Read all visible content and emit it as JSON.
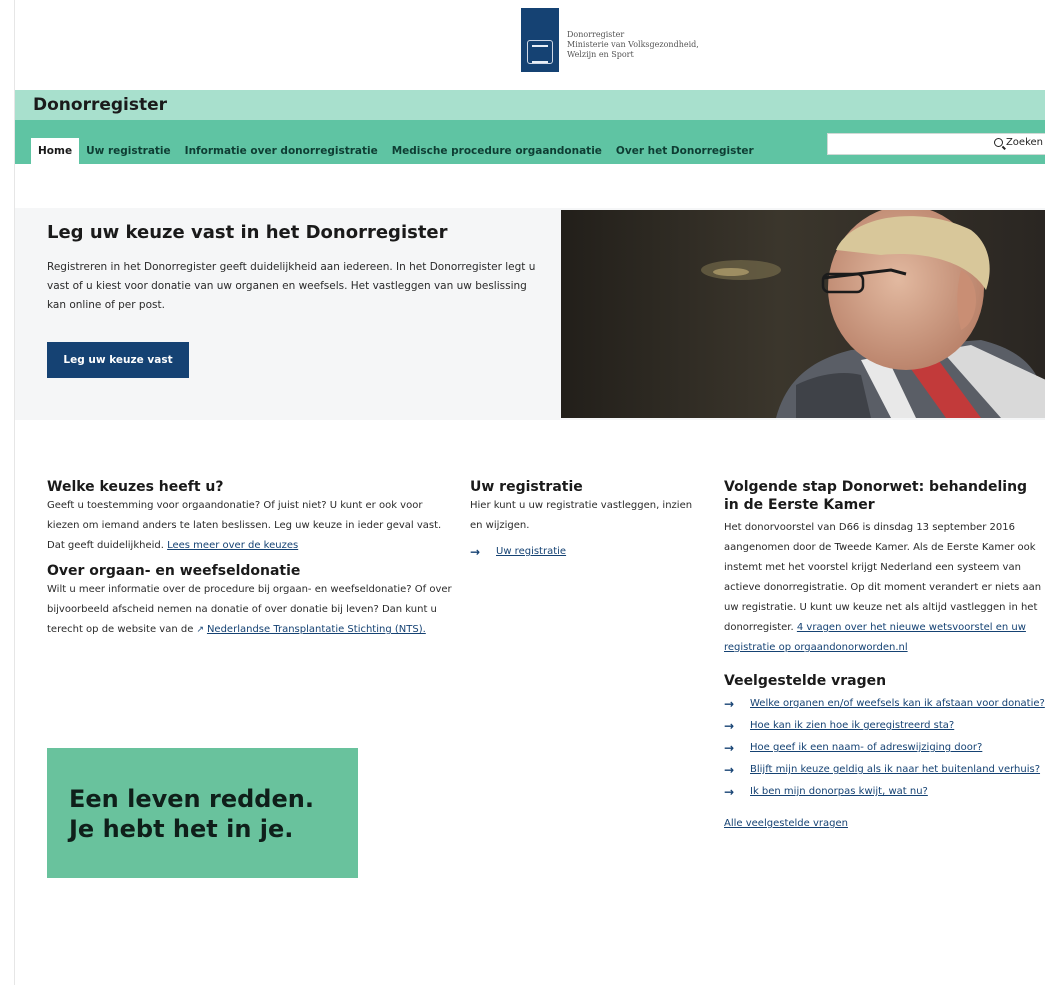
{
  "header": {
    "logo_lines": [
      "Donorregister",
      "Ministerie van Volksgezondheid,",
      "Welzijn en Sport"
    ],
    "site_title": "Donorregister"
  },
  "nav": {
    "items": [
      {
        "label": "Home",
        "active": true
      },
      {
        "label": "Uw registratie"
      },
      {
        "label": "Informatie over donorregistratie"
      },
      {
        "label": "Medische procedure orgaandonatie"
      },
      {
        "label": "Over het Donorregister"
      }
    ],
    "search_button": "Zoeken",
    "search_placeholder": ""
  },
  "hero": {
    "title": "Leg uw keuze vast in het Donorregister",
    "text": "Registreren in het Donorregister geeft duidelijkheid aan iedereen. In het Donorregister legt u vast of u kiest voor donatie van uw organen en weefsels. Het vastleggen van uw beslissing kan online of per post.",
    "button": "Leg uw keuze vast"
  },
  "col1": {
    "s1_title": "Welke keuzes heeft u?",
    "s1_text": "Geeft u toestemming voor orgaandonatie? Of juist niet? U kunt er ook voor kiezen om iemand anders te laten beslissen. Leg uw keuze in ieder geval vast. Dat geeft duidelijkheid. ",
    "s1_link": "Lees meer over de keuzes",
    "s2_title": "Over orgaan- en weefseldonatie",
    "s2_text": "Wilt u meer informatie over de procedure bij orgaan- en weefseldonatie? Of over bijvoorbeeld afscheid nemen na donatie of over donatie bij leven? Dan kunt u terecht op de website van de ",
    "s2_link": "Nederlandse Transplantatie Stichting (NTS).",
    "banner_line1": "Een leven redden.",
    "banner_line2": "Je hebt het in je."
  },
  "col2": {
    "title": "Uw registratie",
    "text": "Hier kunt u uw registratie vastleggen, inzien en wijzigen.",
    "link": "Uw registratie"
  },
  "col3": {
    "title": "Volgende stap Donorwet: behandeling in de Eerste Kamer",
    "text": "Het donorvoorstel van D66 is dinsdag 13 september 2016 aangenomen door de Tweede Kamer. Als de Eerste Kamer ook instemt met het voorstel krijgt Nederland een systeem van actieve donorregistratie. Op dit moment verandert er niets aan uw registratie. U kunt uw keuze net als altijd vastleggen in het donorregister. ",
    "link": "4 vragen over het nieuwe wetsvoorstel en uw registratie op orgaandonorworden.nl",
    "faq_title": "Veelgestelde vragen",
    "faq": [
      "Welke organen en/of weefsels kan ik afstaan voor donatie?",
      "Hoe kan ik zien hoe ik geregistreerd sta?",
      "Hoe geef ik een naam- of adreswijziging door?",
      "Blijft mijn keuze geldig als ik naar het buitenland verhuis?",
      "Ik ben mijn donorpas kwijt, wat nu?"
    ],
    "all_faq": "Alle veelgestelde vragen"
  }
}
